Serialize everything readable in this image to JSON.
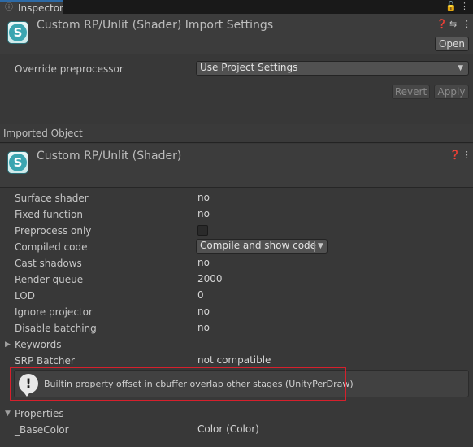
{
  "tab": {
    "label": "Inspector",
    "icon": "info-icon",
    "menu_icon": "kebab-icon",
    "lock_icon": "lock-icon"
  },
  "header": {
    "title": "Custom RP/Unlit (Shader) Import Settings",
    "open_label": "Open",
    "help_icon": "help-icon",
    "preset_icon": "preset-sliders-icon",
    "menu_icon": "kebab-icon"
  },
  "import_settings": {
    "override_label": "Override preprocessor",
    "override_value": "Use Project Settings",
    "revert_label": "Revert",
    "apply_label": "Apply"
  },
  "imported_object": {
    "section_label": "Imported Object",
    "title": "Custom RP/Unlit (Shader)"
  },
  "properties": [
    {
      "label": "Surface shader",
      "value": "no"
    },
    {
      "label": "Fixed function",
      "value": "no"
    },
    {
      "label": "Preprocess only",
      "value": ""
    },
    {
      "label": "Compiled code",
      "value": "Compile and show code"
    },
    {
      "label": "Cast shadows",
      "value": "no"
    },
    {
      "label": "Render queue",
      "value": "2000"
    },
    {
      "label": "LOD",
      "value": "0"
    },
    {
      "label": "Ignore projector",
      "value": "no"
    },
    {
      "label": "Disable batching",
      "value": "no"
    }
  ],
  "keywords_label": "Keywords",
  "srp_batcher": {
    "label": "SRP Batcher",
    "value": "not compatible"
  },
  "warning": {
    "icon": "warning-icon",
    "text": "Builtin property offset in cbuffer overlap other stages (UnityPerDraw)"
  },
  "properties_section": {
    "label": "Properties",
    "items": [
      {
        "label": "_BaseColor",
        "value": "Color (Color)"
      }
    ]
  },
  "colors": {
    "accent": "#2d6aa6",
    "highlight": "#d6202c",
    "background": "#383838"
  }
}
